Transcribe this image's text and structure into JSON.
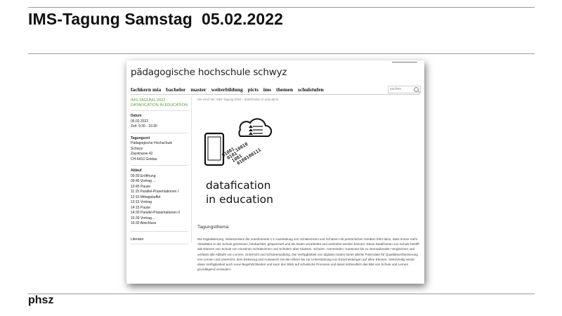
{
  "slide": {
    "title_left": "IMS-Tagung Samstag",
    "title_date": "05.02.2022",
    "footer": "phsz"
  },
  "website": {
    "site_title": "pädagogische hochschule schwyz",
    "nav": [
      "fachkern mia",
      "bachelor",
      "master",
      "weiterbildung",
      "picts",
      "ims",
      "themen",
      "schulstufen"
    ],
    "search_placeholder": "suchen",
    "breadcrumb": "Sie sind hier: IMS-Tagung 2022 - datafication in education",
    "sidebar": {
      "heading": "IMS-TAGUNG 2022 - DATAFICATION IN EDUCATION",
      "datum_label": "Datum",
      "datum_date": "05.02.2022",
      "datum_time": "Zeit: 9:30 - 16:30",
      "ort_label": "Tagungsort",
      "ort_lines": [
        "Pädagogische Hochschule",
        "Schwyz",
        "Zaystrasse 42",
        "CH-6410 Goldau"
      ],
      "ablauf_label": "Ablauf",
      "ablauf_items": [
        "09:30 Eröffnung",
        "09:45 Vortrag ...",
        "10:45 Pause",
        "11:15 Parallel-Präsentationen I",
        "12:15 Mittagsbuffet",
        "13:15 Vortrag",
        "14:15 Pause",
        "14:30 Parallel-Präsentationen II",
        "15:30 Vortrag ...",
        "16:30 Abschluss"
      ],
      "literatur": "Literatur"
    },
    "hero": {
      "line1": "datafication",
      "line2": "in education"
    },
    "theme": {
      "title": "Tagungsthema",
      "body": "Die Digitalisierung, insbesondere die zunehmende 1:1-Ausstattung von Schülerinnen und Schülern mit persönlichen Geräten führt dazu, dass immer mehr Aktivitäten in der Schule gemessen, beobachtet, gespeichert und als Daten verarbeitet und verbreitet werden können. Diese Datafication von Schule betrifft alle Ebenen von Schule von einzelnen Schülerinnen und Schülern über Klassen, Schulen, Gemeinden, Kantonen bis zu internationalen Vergleichen und umfasst alle Abläufe von Lernen, Unterricht und Schulverwaltung. Die Verfügbarkeit von digitalen Daten bietet allerlei Potenziale für Qualitätsverbesserung von Lernen und Unterricht, dem Einbezug und Austausch mit den Eltern bis zur Unterstützung von Entscheidungen auf allen Ebenen. Gleichzeitig weckt diese Verfügbarkeit auch neue Begehrlichkeiten und kann den Blick auf schulische Prozesse und damit letztendlich das Bild von Schule und Lernen grundlegend verändern."
    },
    "binary_text": [
      "01001",
      "0101",
      "1001",
      "10010",
      "0100100111"
    ]
  }
}
